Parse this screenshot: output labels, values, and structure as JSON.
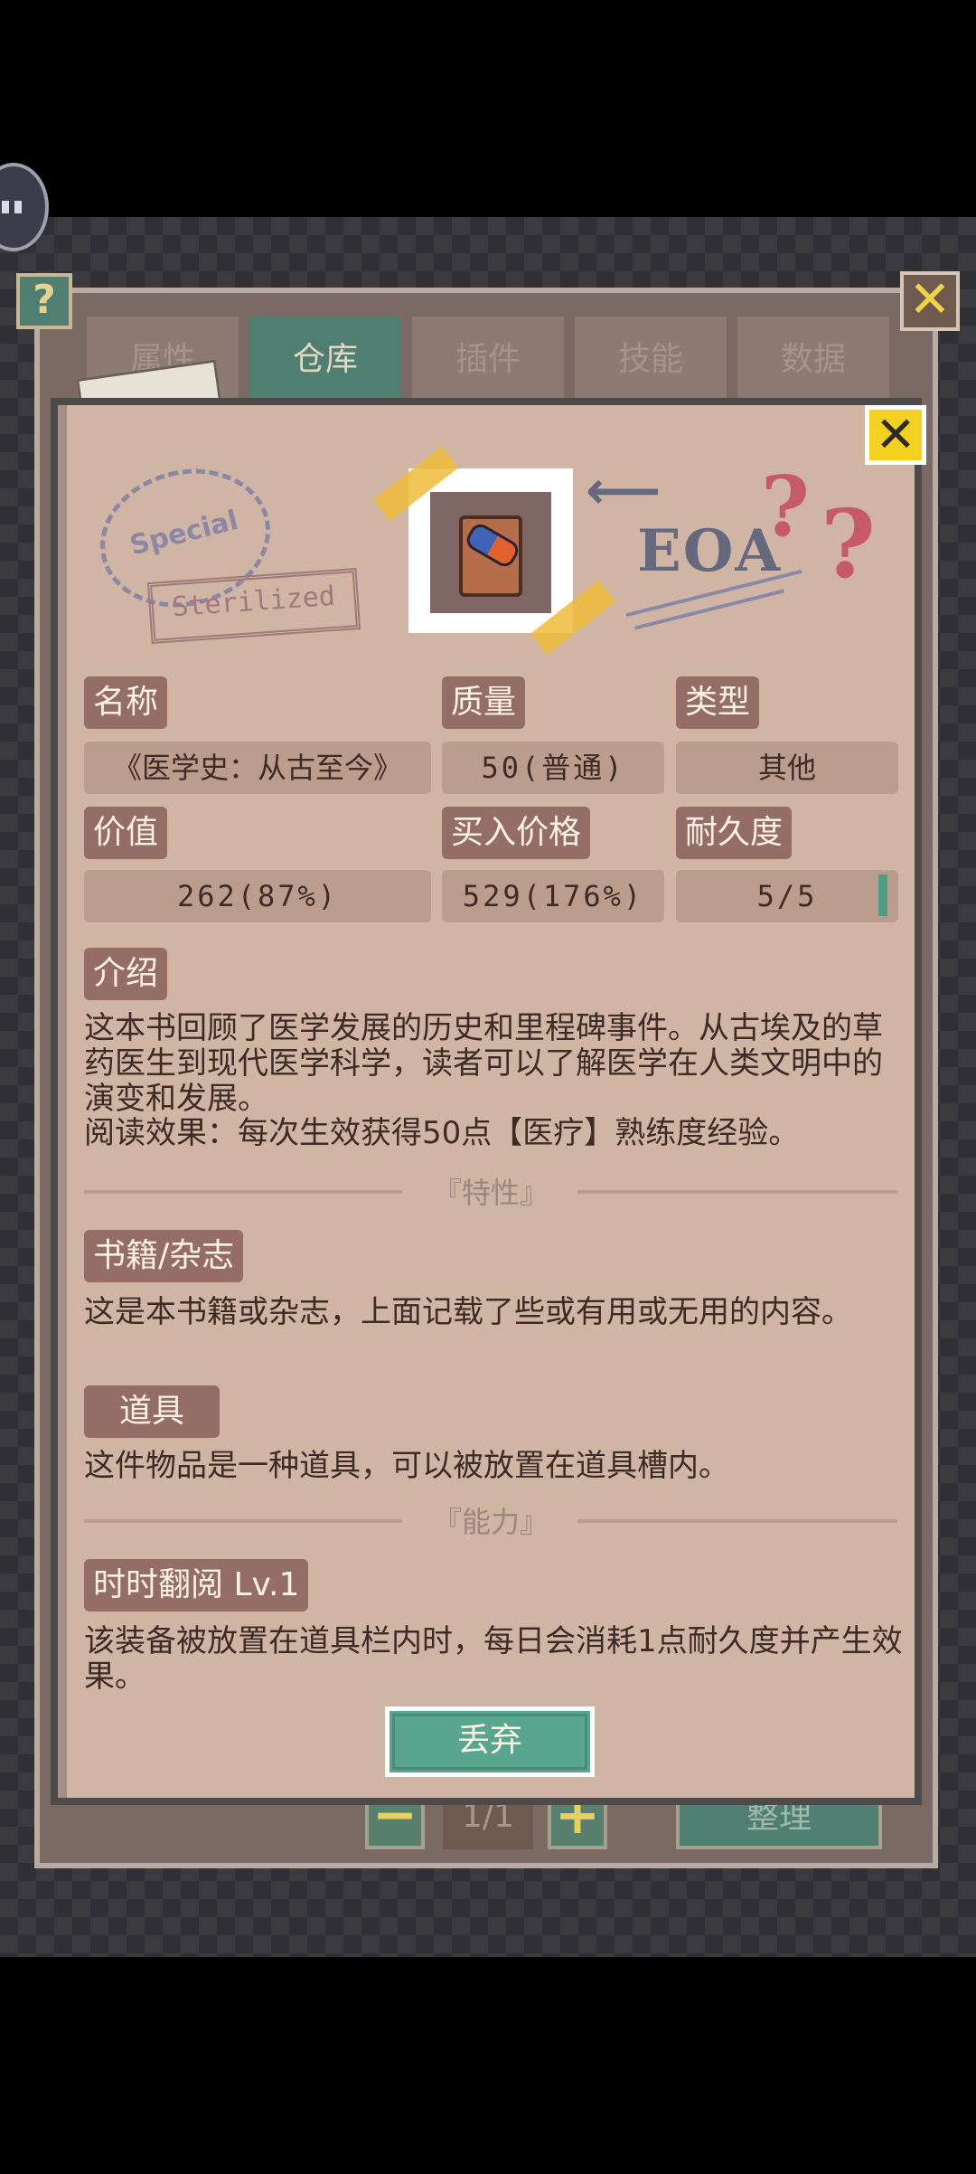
{
  "tabs": [
    {
      "label": "属性",
      "active": false
    },
    {
      "label": "仓库",
      "active": true
    },
    {
      "label": "插件",
      "active": false
    },
    {
      "label": "技能",
      "active": false
    },
    {
      "label": "数据",
      "active": false
    }
  ],
  "help_button": "?",
  "close_glyph": "✕",
  "pager": {
    "minus": "−",
    "label": "1/1",
    "plus": "+"
  },
  "sort_button": "整理",
  "decorations": {
    "stamp_circle_text": "Special",
    "stamp_rect_text": "Sterilized",
    "eoa_text": "EOA",
    "question_mark": "?",
    "arrow_glyph": "⟵"
  },
  "item": {
    "icon": "medical-book-icon",
    "labels": {
      "name": "名称",
      "quality": "质量",
      "type": "类型",
      "value": "价值",
      "buy_price": "买入价格",
      "durability": "耐久度",
      "intro": "介绍"
    },
    "name": "《医学史：从古至今》",
    "quality": "50(普通)",
    "type": "其他",
    "value": "262(87%)",
    "buy_price": "529(176%)",
    "durability": "5/5",
    "durability_fraction": 1.0,
    "intro_text": "这本书回顾了医学发展的历史和里程碑事件。从古埃及的草药医生到现代医学科学，读者可以了解医学在人类文明中的演变和发展。",
    "effect_text": "阅读效果：每次生效获得50点【医疗】熟练度经验。"
  },
  "traits": {
    "header": "『特性』",
    "items": [
      {
        "name": "书籍/杂志",
        "desc": "这是本书籍或杂志，上面记载了些或有用或无用的内容。"
      },
      {
        "name": "道具",
        "desc": "这件物品是一种道具，可以被放置在道具槽内。"
      }
    ]
  },
  "abilities": {
    "header": "『能力』",
    "items": [
      {
        "name": "时时翻阅 Lv.1",
        "desc": "该装备被放置在道具栏内时，每日会消耗1点耐久度并产生效果。"
      }
    ]
  },
  "discard_button": "丢弃",
  "colors": {
    "accent_green": "#4f7f71",
    "paper": "#d0b5a4",
    "tag_bg": "#946d66",
    "close_yellow": "#f3d11f"
  }
}
